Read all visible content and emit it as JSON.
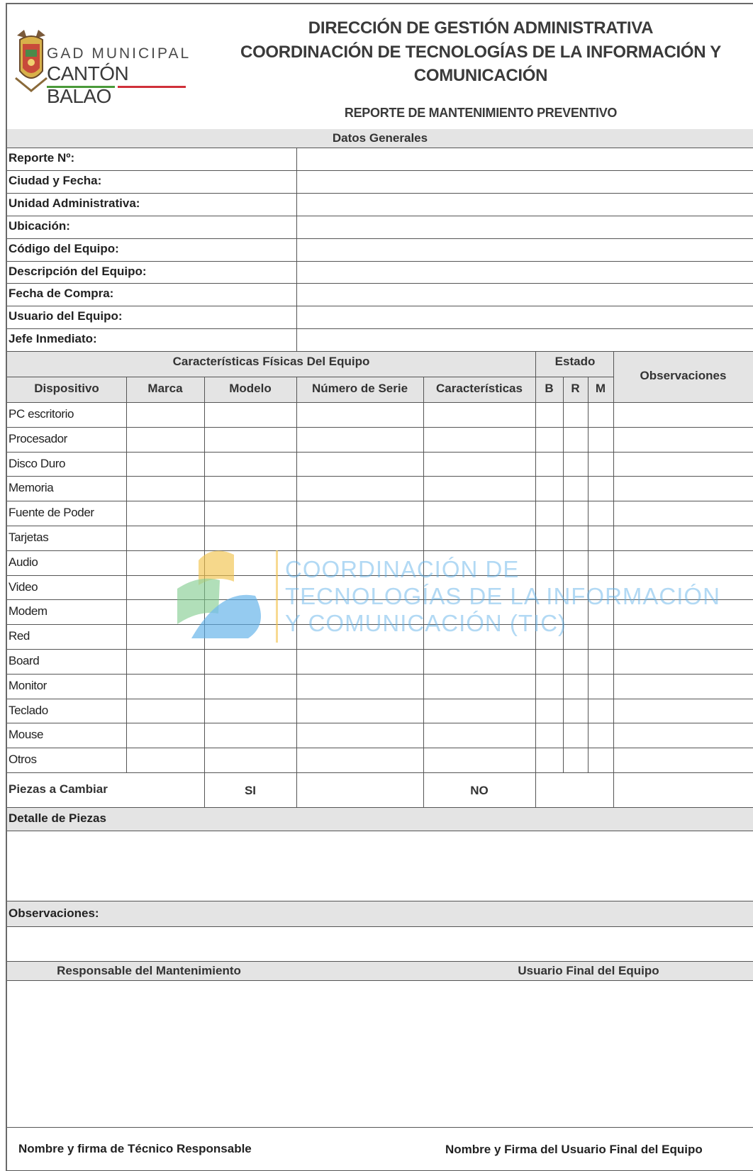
{
  "header": {
    "org_line1": "GAD MUNICIPAL",
    "org_line2": "CANTÓN BALAO",
    "title_line1": "DIRECCIÓN DE GESTIÓN ADMINISTRATIVA",
    "title_line2": "COORDINACIÓN DE TECNOLOGÍAS DE LA INFORMACIÓN Y",
    "title_line3": "COMUNICACIÓN",
    "report_title": "REPORTE DE MANTENIMIENTO PREVENTIVO"
  },
  "general": {
    "section_title": "Datos Generales",
    "fields": [
      "Reporte Nº:",
      "Ciudad y Fecha:",
      "Unidad Administrativa:",
      "Ubicación:",
      "Código del Equipo:",
      "Descripción del Equipo:",
      "Fecha de Compra:",
      "Usuario del Equipo:",
      "Jefe Inmediato:"
    ]
  },
  "physical": {
    "section_title": "Características Físicas Del Equipo",
    "estado_title": "Estado",
    "observaciones_title": "Observaciones",
    "columns": [
      "Dispositivo",
      "Marca",
      "Modelo",
      "Número de Serie",
      "Características",
      "B",
      "R",
      "M"
    ],
    "devices": [
      "PC escritorio",
      "Procesador",
      "Disco Duro",
      "Memoria",
      "Fuente de Poder",
      "Tarjetas",
      "Audio",
      "Video",
      "Modem",
      "Red",
      "Board",
      "Monitor",
      "Teclado",
      "Mouse",
      "Otros"
    ]
  },
  "parts": {
    "label": "Piezas a Cambiar",
    "yes": "SI",
    "no": "NO",
    "detail_label": "Detalle de Piezas",
    "observations_label": "Observaciones:"
  },
  "signatures": {
    "left_title": "Responsable del Mantenimiento",
    "right_title": "Usuario Final del Equipo",
    "left_footer": "Nombre y firma de Técnico Responsable",
    "right_footer": "Nombre y Firma del Usuario Final del Equipo"
  },
  "watermark": {
    "line1": "COORDINACIÓN DE",
    "line2": "TECNOLOGÍAS DE LA INFORMACIÓN",
    "line3": "Y COMUNICACIÓN (TIC)"
  }
}
